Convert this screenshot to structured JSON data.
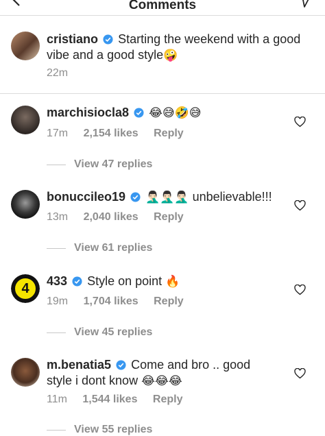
{
  "header": {
    "title": "Comments"
  },
  "colors": {
    "verified": "#3897f0",
    "muted": "#8e8e8e",
    "text": "#262626"
  },
  "caption": {
    "username": "cristiano",
    "text_line1": "Starting the weekend with a good",
    "text_line2": "vibe and a good style",
    "emoji": "🤪",
    "time": "22m"
  },
  "comments": [
    {
      "username": "marchisiocla8",
      "text": "",
      "emoji": "😂😅🤣😅",
      "time": "17m",
      "likes": "2,154 likes",
      "reply": "Reply",
      "view_replies": "View 47 replies"
    },
    {
      "username": "bonucci leo19",
      "display_username": "bonuccileo19",
      "text": "unbelievable!!!",
      "emoji": "🤦🏻‍♂️🤦🏻‍♂️🤦🏻‍♂️",
      "time": "13m",
      "likes": "2,040 likes",
      "reply": "Reply",
      "view_replies": "View 61 replies"
    },
    {
      "username": "433",
      "text": "Style on point",
      "emoji": "🔥",
      "time": "19m",
      "likes": "1,704 likes",
      "reply": "Reply",
      "view_replies": "View 45 replies",
      "avatar_text": "4"
    },
    {
      "username": "m.benatia5",
      "text_line1": "Come and bro .. good",
      "text_line2": "style i dont know",
      "emoji": "😂😂😂",
      "time": "11m",
      "likes": "1,544 likes",
      "reply": "Reply",
      "view_replies": "View 55 replies"
    }
  ]
}
